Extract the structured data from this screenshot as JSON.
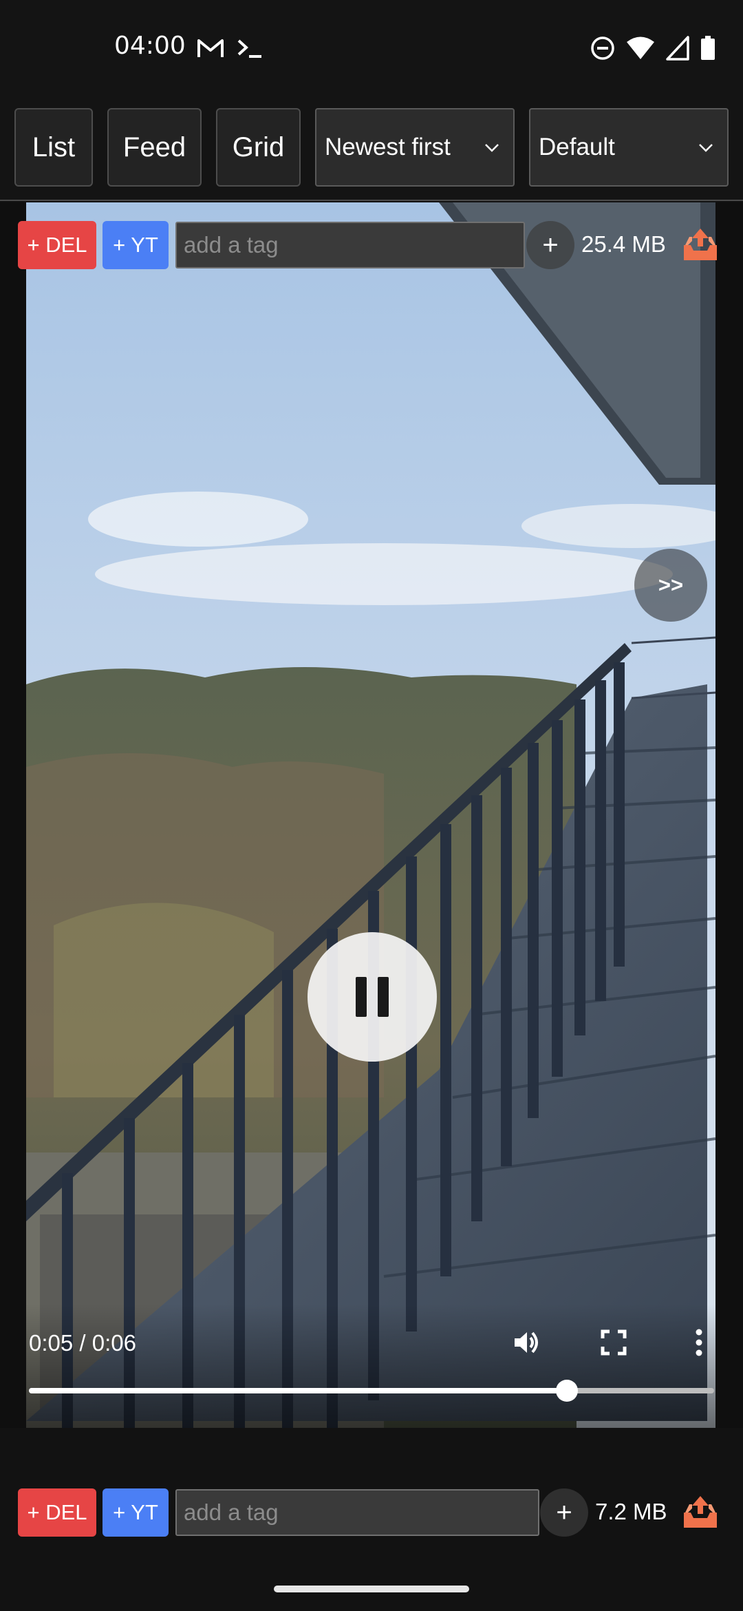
{
  "status_bar": {
    "time": "04:00",
    "left_icons": [
      "gmail-icon",
      "terminal-icon"
    ],
    "right_icons": [
      "do-not-disturb-icon",
      "wifi-icon",
      "signal-icon",
      "battery-icon"
    ]
  },
  "toolbar": {
    "view_buttons": [
      "List",
      "Feed",
      "Grid"
    ],
    "sort_select": "Newest first",
    "filter_select": "Default"
  },
  "items": [
    {
      "del_label": "+ DEL",
      "yt_label": "+ YT",
      "tag_placeholder": "add a tag",
      "add_symbol": "+",
      "size": "25.4 MB",
      "forward_label": ">>",
      "player": {
        "time": "0:05 / 0:06",
        "progress": 0.785,
        "state": "playing"
      }
    },
    {
      "del_label": "+ DEL",
      "yt_label": "+ YT",
      "tag_placeholder": "add a tag",
      "add_symbol": "+",
      "size": "7.2 MB"
    }
  ],
  "colors": {
    "del": "#e64545",
    "yt": "#4b7ff5",
    "upload_tray": "#f0724b",
    "background": "#121212"
  }
}
